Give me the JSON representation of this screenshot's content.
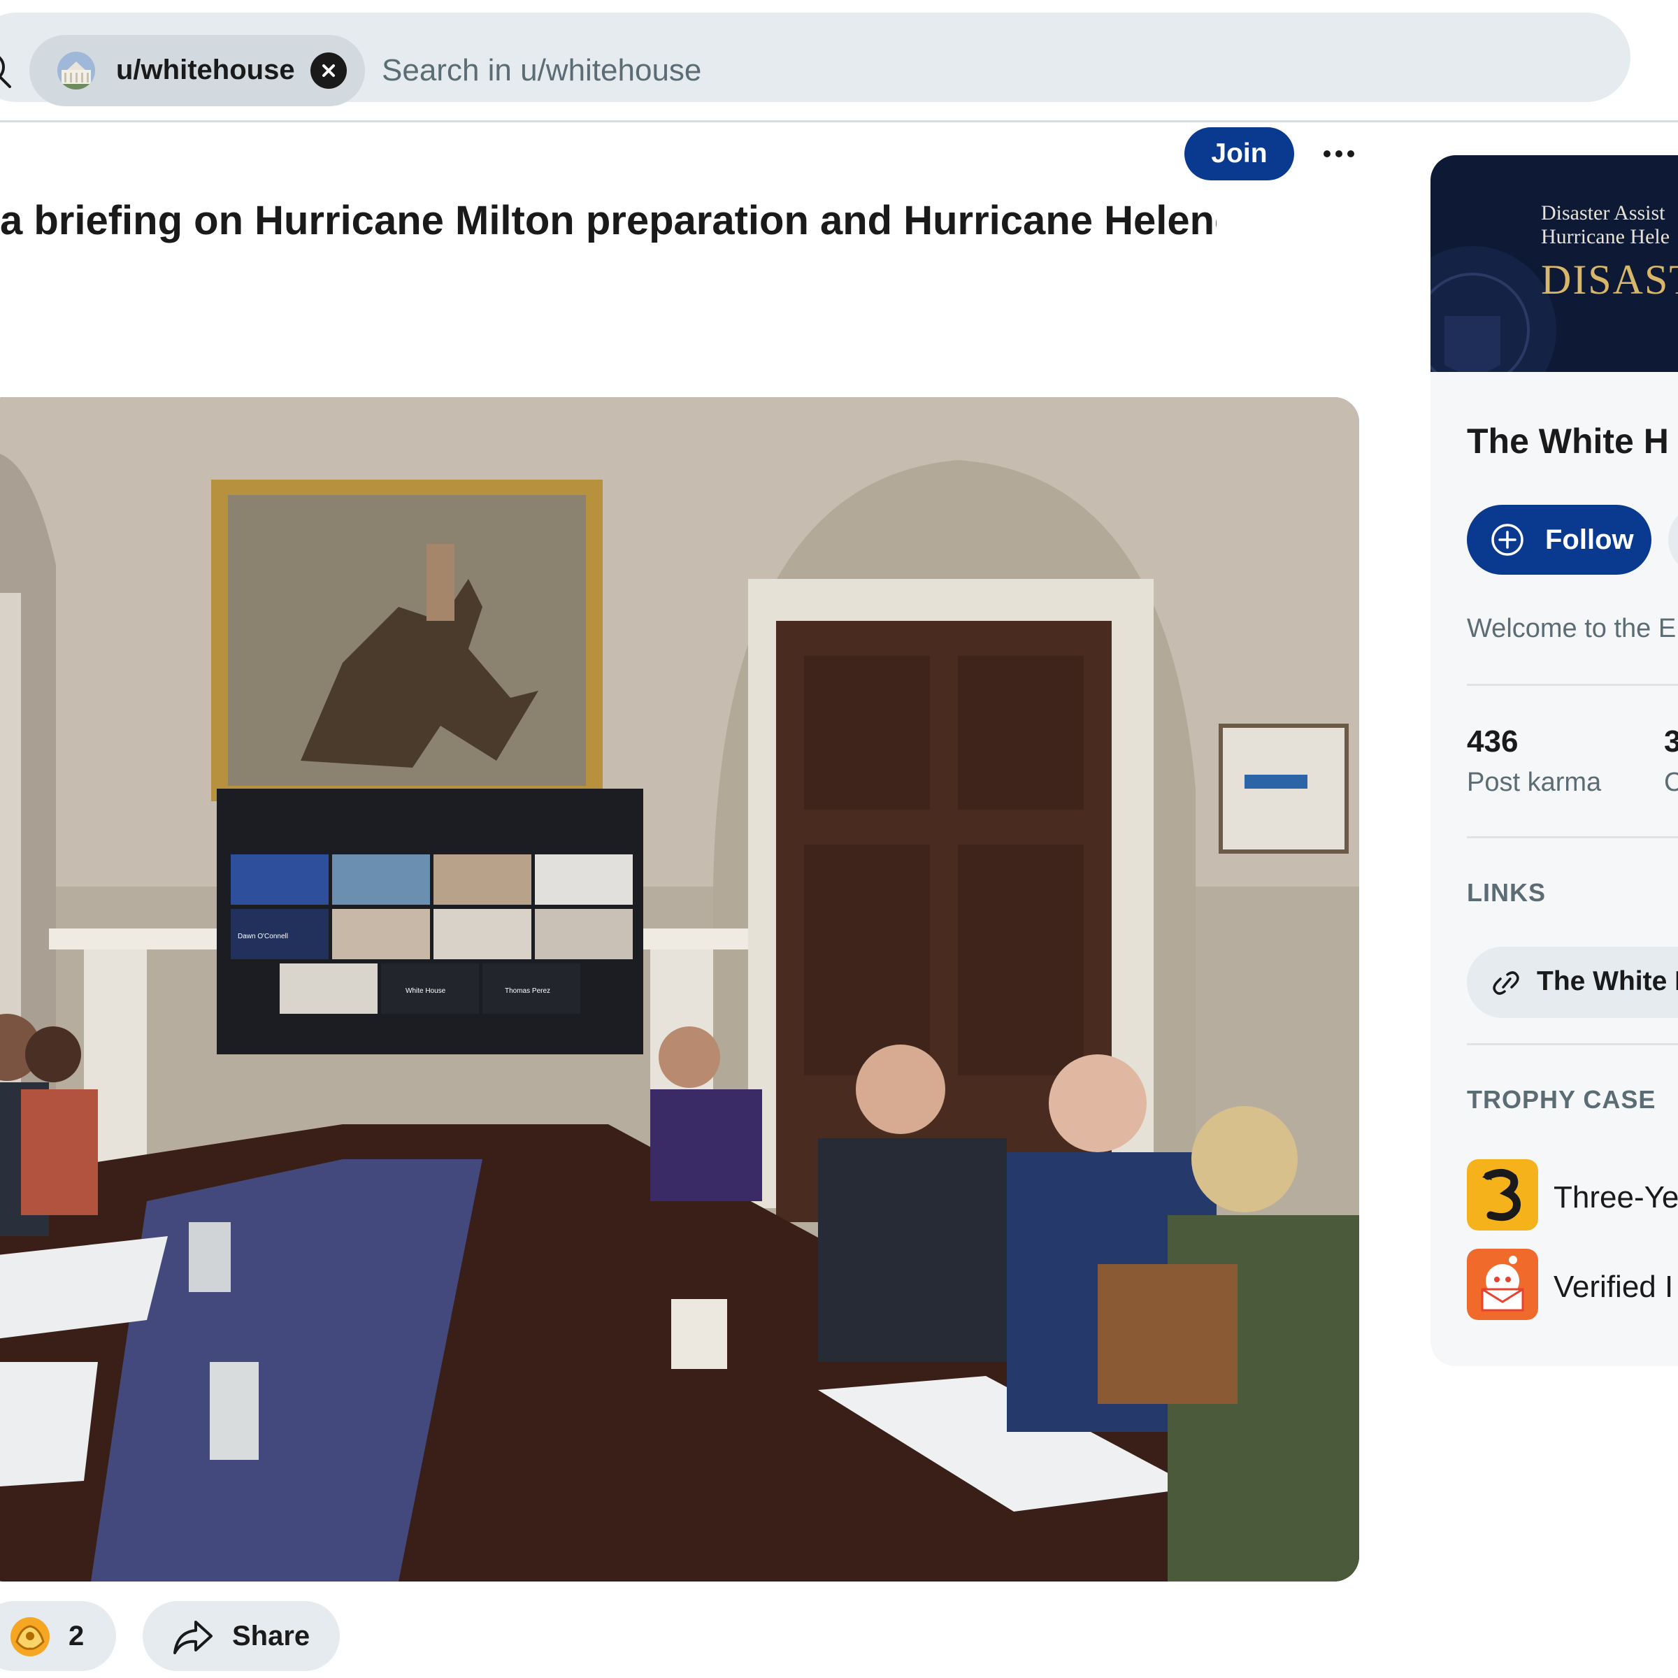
{
  "search": {
    "chip_label": "u/whitehouse",
    "placeholder": "Search in u/whitehouse"
  },
  "post": {
    "join_label": "Join",
    "title": "a briefing on Hurricane Milton preparation and Hurricane Helene",
    "award_count": "2",
    "share_label": "Share",
    "image_screen_labels": [
      "Dawn O'Connell",
      "White House",
      "Thomas Perez"
    ]
  },
  "sidebar": {
    "banner_line1": "Disaster Assist",
    "banner_line2": "Hurricane Hele",
    "banner_big": "DISAST",
    "profile_name": "The White H",
    "follow_label": "Follow",
    "description": "Welcome to the E",
    "post_karma_value": "436",
    "post_karma_label": "Post karma",
    "second_stat_value": "3",
    "second_stat_label": "C",
    "links_heading": "LINKS",
    "link_label": "The White I",
    "trophy_heading": "TROPHY CASE",
    "trophies": [
      {
        "label": "Three-Ye",
        "icon": "three-year-club-icon"
      },
      {
        "label": "Verified I",
        "icon": "verified-email-icon"
      }
    ]
  },
  "colors": {
    "brand_blue": "#0a3a8f",
    "chip_gray": "#e5ebee",
    "muted_text": "#5c6c74",
    "banner_navy": "#0e1a35",
    "banner_gold": "#d9b76a"
  }
}
